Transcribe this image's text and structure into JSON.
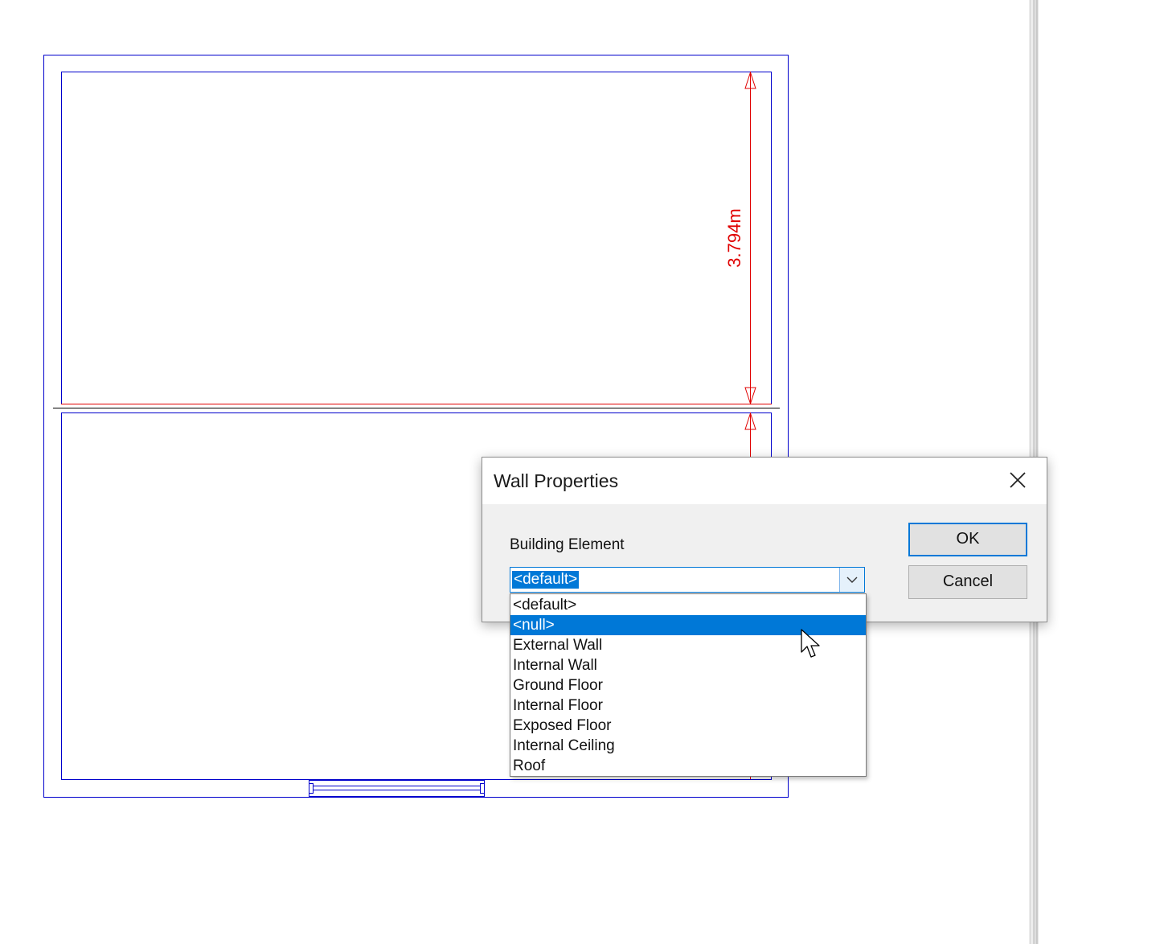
{
  "drawing": {
    "dimension_label": "3.794m",
    "wall_color": "#0000cc",
    "dimension_color": "#e00000"
  },
  "dialog": {
    "title": "Wall Properties",
    "close_icon": "close-icon",
    "field_label": "Building Element",
    "selected_value": "<default>",
    "ok_label": "OK",
    "cancel_label": "Cancel",
    "accent_color": "#0078d7"
  },
  "dropdown": {
    "highlighted": "<null>",
    "options": [
      "<default>",
      "<null>",
      "External Wall",
      "Internal Wall",
      "Ground Floor",
      "Internal Floor",
      "Exposed Floor",
      "Internal Ceiling",
      "Roof"
    ]
  }
}
